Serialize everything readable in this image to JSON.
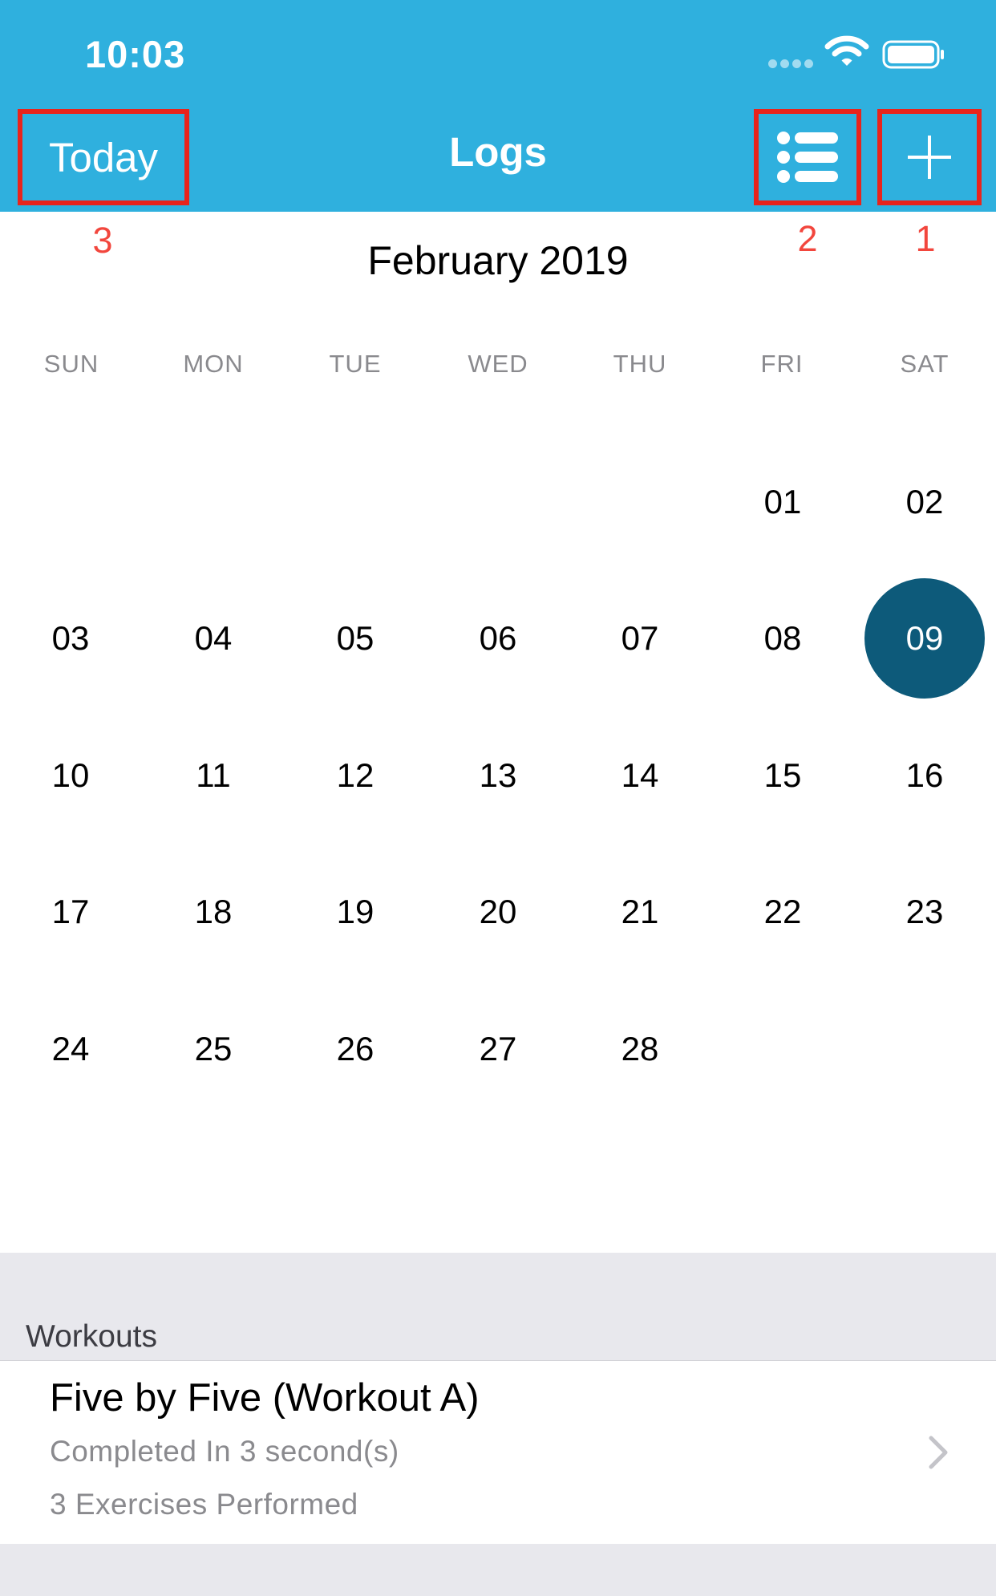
{
  "status_bar": {
    "time": "10:03"
  },
  "nav": {
    "title": "Logs",
    "today_label": "Today",
    "list_icon": "list-icon",
    "add_icon": "plus-icon",
    "header_color": "#2fb0de"
  },
  "annotations": {
    "marker_1": "1",
    "marker_2": "2",
    "marker_3": "3",
    "box_color": "#e8241c"
  },
  "calendar": {
    "month_title": "February 2019",
    "weekdays": [
      "SUN",
      "MON",
      "TUE",
      "WED",
      "THU",
      "FRI",
      "SAT"
    ],
    "weeks": [
      [
        "",
        "",
        "",
        "",
        "",
        "01",
        "02"
      ],
      [
        "03",
        "04",
        "05",
        "06",
        "07",
        "08",
        "09"
      ],
      [
        "10",
        "11",
        "12",
        "13",
        "14",
        "15",
        "16"
      ],
      [
        "17",
        "18",
        "19",
        "20",
        "21",
        "22",
        "23"
      ],
      [
        "24",
        "25",
        "26",
        "27",
        "28",
        "",
        ""
      ]
    ],
    "selected_day": "09",
    "selected_color": "#0d5a7a"
  },
  "workouts": {
    "section_label": "Workouts",
    "items": [
      {
        "name": "Five by Five (Workout A)",
        "completed": "Completed In 3 second(s)",
        "exercises": "3 Exercises Performed"
      }
    ]
  }
}
